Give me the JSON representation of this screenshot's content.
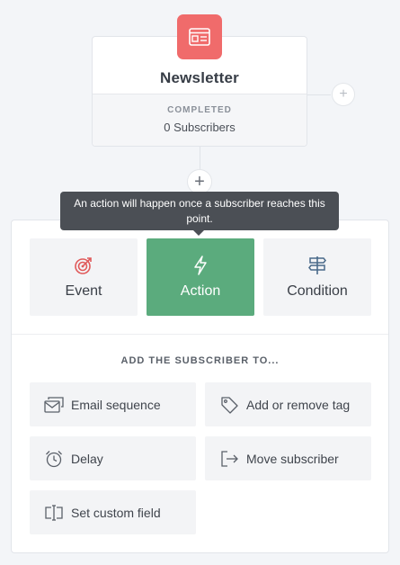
{
  "node": {
    "title": "Newsletter",
    "status": "COMPLETED",
    "count": "0 Subscribers",
    "icon": "newsletter-icon",
    "icon_color": "#f06b6b"
  },
  "connectors": {
    "add_branch": "+",
    "add_step": "+"
  },
  "tooltip": {
    "text": "An action will happen once a subscriber reaches this point."
  },
  "types": [
    {
      "label": "Event",
      "icon": "target-icon",
      "active": false
    },
    {
      "label": "Action",
      "icon": "lightning-icon",
      "active": true
    },
    {
      "label": "Condition",
      "icon": "signpost-icon",
      "active": false
    }
  ],
  "section_heading": "ADD THE SUBSCRIBER TO...",
  "options": [
    {
      "label": "Email sequence",
      "icon": "email-sequence-icon"
    },
    {
      "label": "Add or remove tag",
      "icon": "tag-icon"
    },
    {
      "label": "Delay",
      "icon": "alarm-clock-icon"
    },
    {
      "label": "Move subscriber",
      "icon": "move-arrow-icon"
    },
    {
      "label": "Set custom field",
      "icon": "custom-field-icon"
    }
  ],
  "colors": {
    "accent_green": "#5bab7d",
    "event_red": "#e05a5a",
    "condition_blue": "#4a6a8a",
    "tooltip_bg": "#4b4f55"
  }
}
